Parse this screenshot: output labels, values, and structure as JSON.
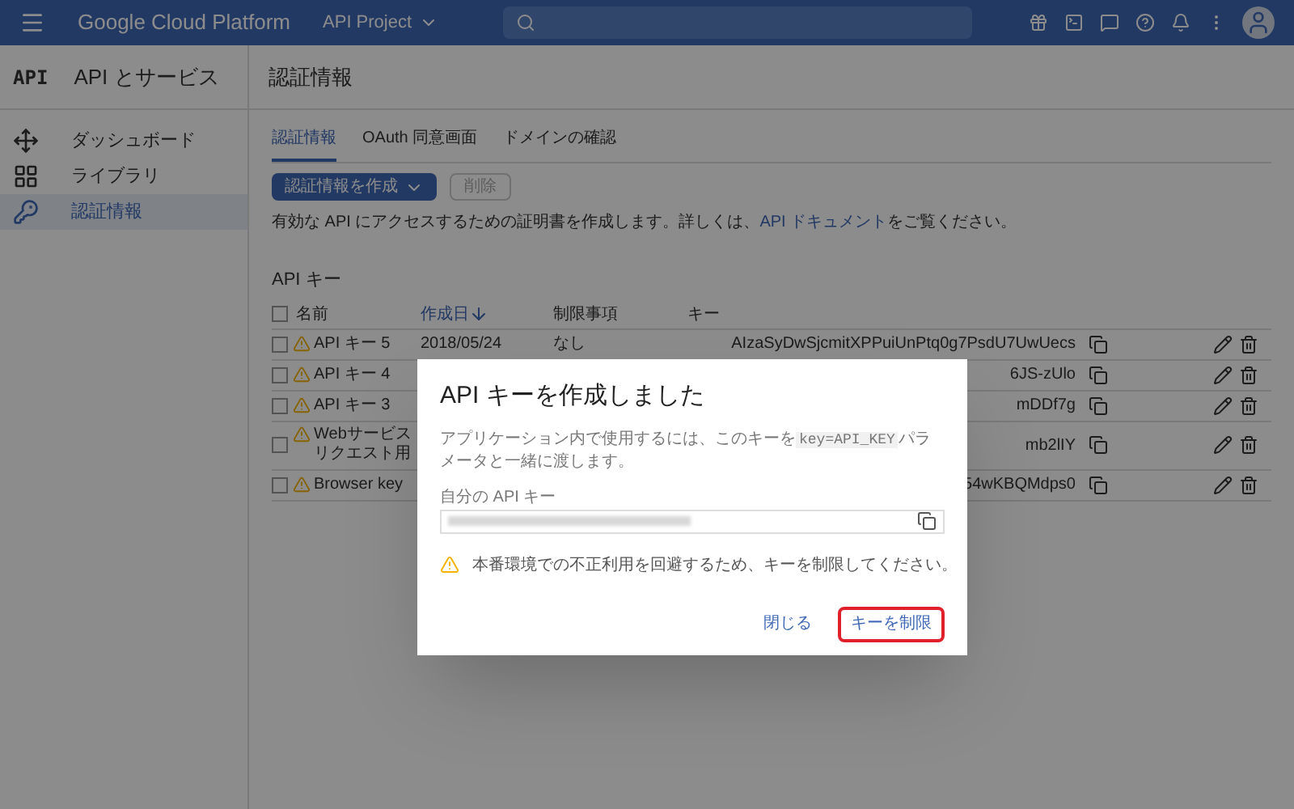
{
  "header": {
    "product": "Google Cloud Platform",
    "project": "API Project"
  },
  "sidebar": {
    "logo": "API",
    "title": "API とサービス",
    "items": [
      {
        "label": "ダッシュボード",
        "selected": false
      },
      {
        "label": "ライブラリ",
        "selected": false
      },
      {
        "label": "認証情報",
        "selected": true
      }
    ]
  },
  "page_title": "認証情報",
  "tabs": [
    {
      "label": "認証情報",
      "selected": true
    },
    {
      "label": "OAuth 同意画面",
      "selected": false
    },
    {
      "label": "ドメインの確認",
      "selected": false
    }
  ],
  "toolbar": {
    "create": "認証情報を作成",
    "delete": "削除"
  },
  "description": {
    "text": "有効な API にアクセスするための証明書を作成します。詳しくは、",
    "link": "API ドキュメント",
    "after": "をご覧ください。"
  },
  "api_keys": {
    "title": "API キー",
    "all_checked": false,
    "columns": [
      "名前",
      "作成日",
      "制限事項",
      "キー"
    ],
    "rows": [
      {
        "checked": false,
        "name": "API キー 5",
        "date": "2018/05/24",
        "restriction": "なし",
        "key": "AIzaSyDwSjcmitXPPuiUnPtq0g7PsdU7UwUecs"
      },
      {
        "checked": false,
        "name": "API キー 4",
        "key": "6JS-zUlo"
      },
      {
        "checked": false,
        "name": "API キー 3",
        "key": "mDDf7g"
      },
      {
        "checked": false,
        "name": "Webサービス",
        "name_line2": "リクエスト用",
        "key": "mb2lIY"
      },
      {
        "checked": false,
        "name": "Browser key",
        "key": "54wKBQMdps0"
      }
    ]
  },
  "dialog": {
    "title": "API キーを作成しました",
    "text_before": "アプリケーション内で使用するには、このキーを",
    "code": "key=API_KEY",
    "text_after": "パラメータと一緒に渡します。",
    "field_label": "自分の API キー",
    "warning": "本番環境での不正利用を回避するため、キーを制限してください。",
    "buttons": [
      {
        "label": "閉じる",
        "highlighted": false
      },
      {
        "label": "キーを制限",
        "highlighted": true
      }
    ]
  }
}
